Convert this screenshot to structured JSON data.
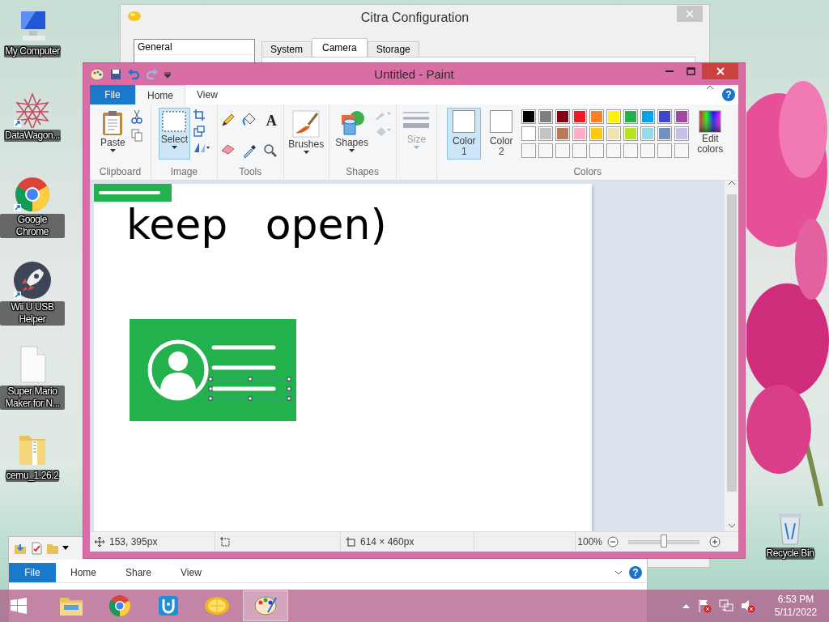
{
  "desktop_icons": [
    {
      "label": "My Computer",
      "kind": "computer"
    },
    {
      "label": "DataWagon...",
      "kind": "star"
    },
    {
      "label": "Google Chrome",
      "kind": "chrome"
    },
    {
      "label": "Wii U USB Helper",
      "kind": "rocket"
    },
    {
      "label": "Super Mario Maker for N...",
      "kind": "file"
    },
    {
      "label": "cemu_1.26.2",
      "kind": "folder"
    }
  ],
  "recycle_bin": {
    "label": "Recycle Bin"
  },
  "citra_window": {
    "title": "Citra Configuration",
    "sidebar": [
      {
        "label": "General",
        "selected": false
      }
    ],
    "tabs": [
      {
        "label": "System",
        "selected": false
      },
      {
        "label": "Camera",
        "selected": true
      },
      {
        "label": "Storage",
        "selected": false
      }
    ]
  },
  "paint_window": {
    "title": "Untitled - Paint",
    "ribbon_tabs": [
      {
        "label": "File",
        "kind": "file",
        "selected": false
      },
      {
        "label": "Home",
        "kind": "tab",
        "selected": true
      },
      {
        "label": "View",
        "kind": "tab",
        "selected": false
      }
    ],
    "help": "?",
    "clipboard": {
      "label": "Clipboard",
      "paste": "Paste"
    },
    "image": {
      "label": "Image",
      "select": {
        "label": "Select",
        "selected": true
      }
    },
    "tools": {
      "label": "Tools",
      "text_tool": "A"
    },
    "brushes": {
      "button": "Brushes"
    },
    "shapes": {
      "label": "Shapes",
      "button": "Shapes"
    },
    "size": {
      "button": "Size",
      "disabled": true
    },
    "colors": {
      "label": "Colors",
      "slots": [
        {
          "label": "Color 1",
          "color": "#ffffff",
          "selected": true
        },
        {
          "label": "Color 2",
          "color": "#ffffff",
          "selected": false
        }
      ],
      "palette": [
        {
          "color": "#000000"
        },
        {
          "color": "#7f7f7f"
        },
        {
          "color": "#880015"
        },
        {
          "color": "#ed1c24"
        },
        {
          "color": "#ff7f27"
        },
        {
          "color": "#fff200"
        },
        {
          "color": "#22b14c"
        },
        {
          "color": "#00a2e8"
        },
        {
          "color": "#3f48cc"
        },
        {
          "color": "#a349a4"
        },
        {
          "color": "#ffffff"
        },
        {
          "color": "#c3c3c3"
        },
        {
          "color": "#b97a57"
        },
        {
          "color": "#ffaec9"
        },
        {
          "color": "#ffc90e"
        },
        {
          "color": "#efe4b0"
        },
        {
          "color": "#b5e61d"
        },
        {
          "color": "#99d9ea"
        },
        {
          "color": "#7092be"
        },
        {
          "color": "#c8bfe7"
        }
      ],
      "edit": "Edit colors"
    },
    "canvas": {
      "handwriting": "keep open)"
    },
    "status_bar": {
      "cursor": "153, 395px",
      "image_size": "614 × 460px",
      "zoom": "100%",
      "zoom_slider": {
        "level": 0.5
      }
    }
  },
  "explorer_window": {
    "tabs": [
      {
        "label": "File",
        "kind": "file",
        "selected": false
      },
      {
        "label": "Home",
        "kind": "tab",
        "selected": false
      },
      {
        "label": "Share",
        "kind": "tab",
        "selected": false
      },
      {
        "label": "View",
        "kind": "tab",
        "selected": false
      }
    ],
    "help": "?"
  },
  "taskbar": {
    "apps": [
      {
        "kind": "explorer",
        "selected": false
      },
      {
        "kind": "chrome",
        "selected": false
      },
      {
        "kind": "wiiu",
        "selected": false
      },
      {
        "kind": "citra",
        "selected": false
      },
      {
        "kind": "paint",
        "selected": true
      }
    ],
    "time": "6:53 PM",
    "date": "5/11/2022"
  }
}
